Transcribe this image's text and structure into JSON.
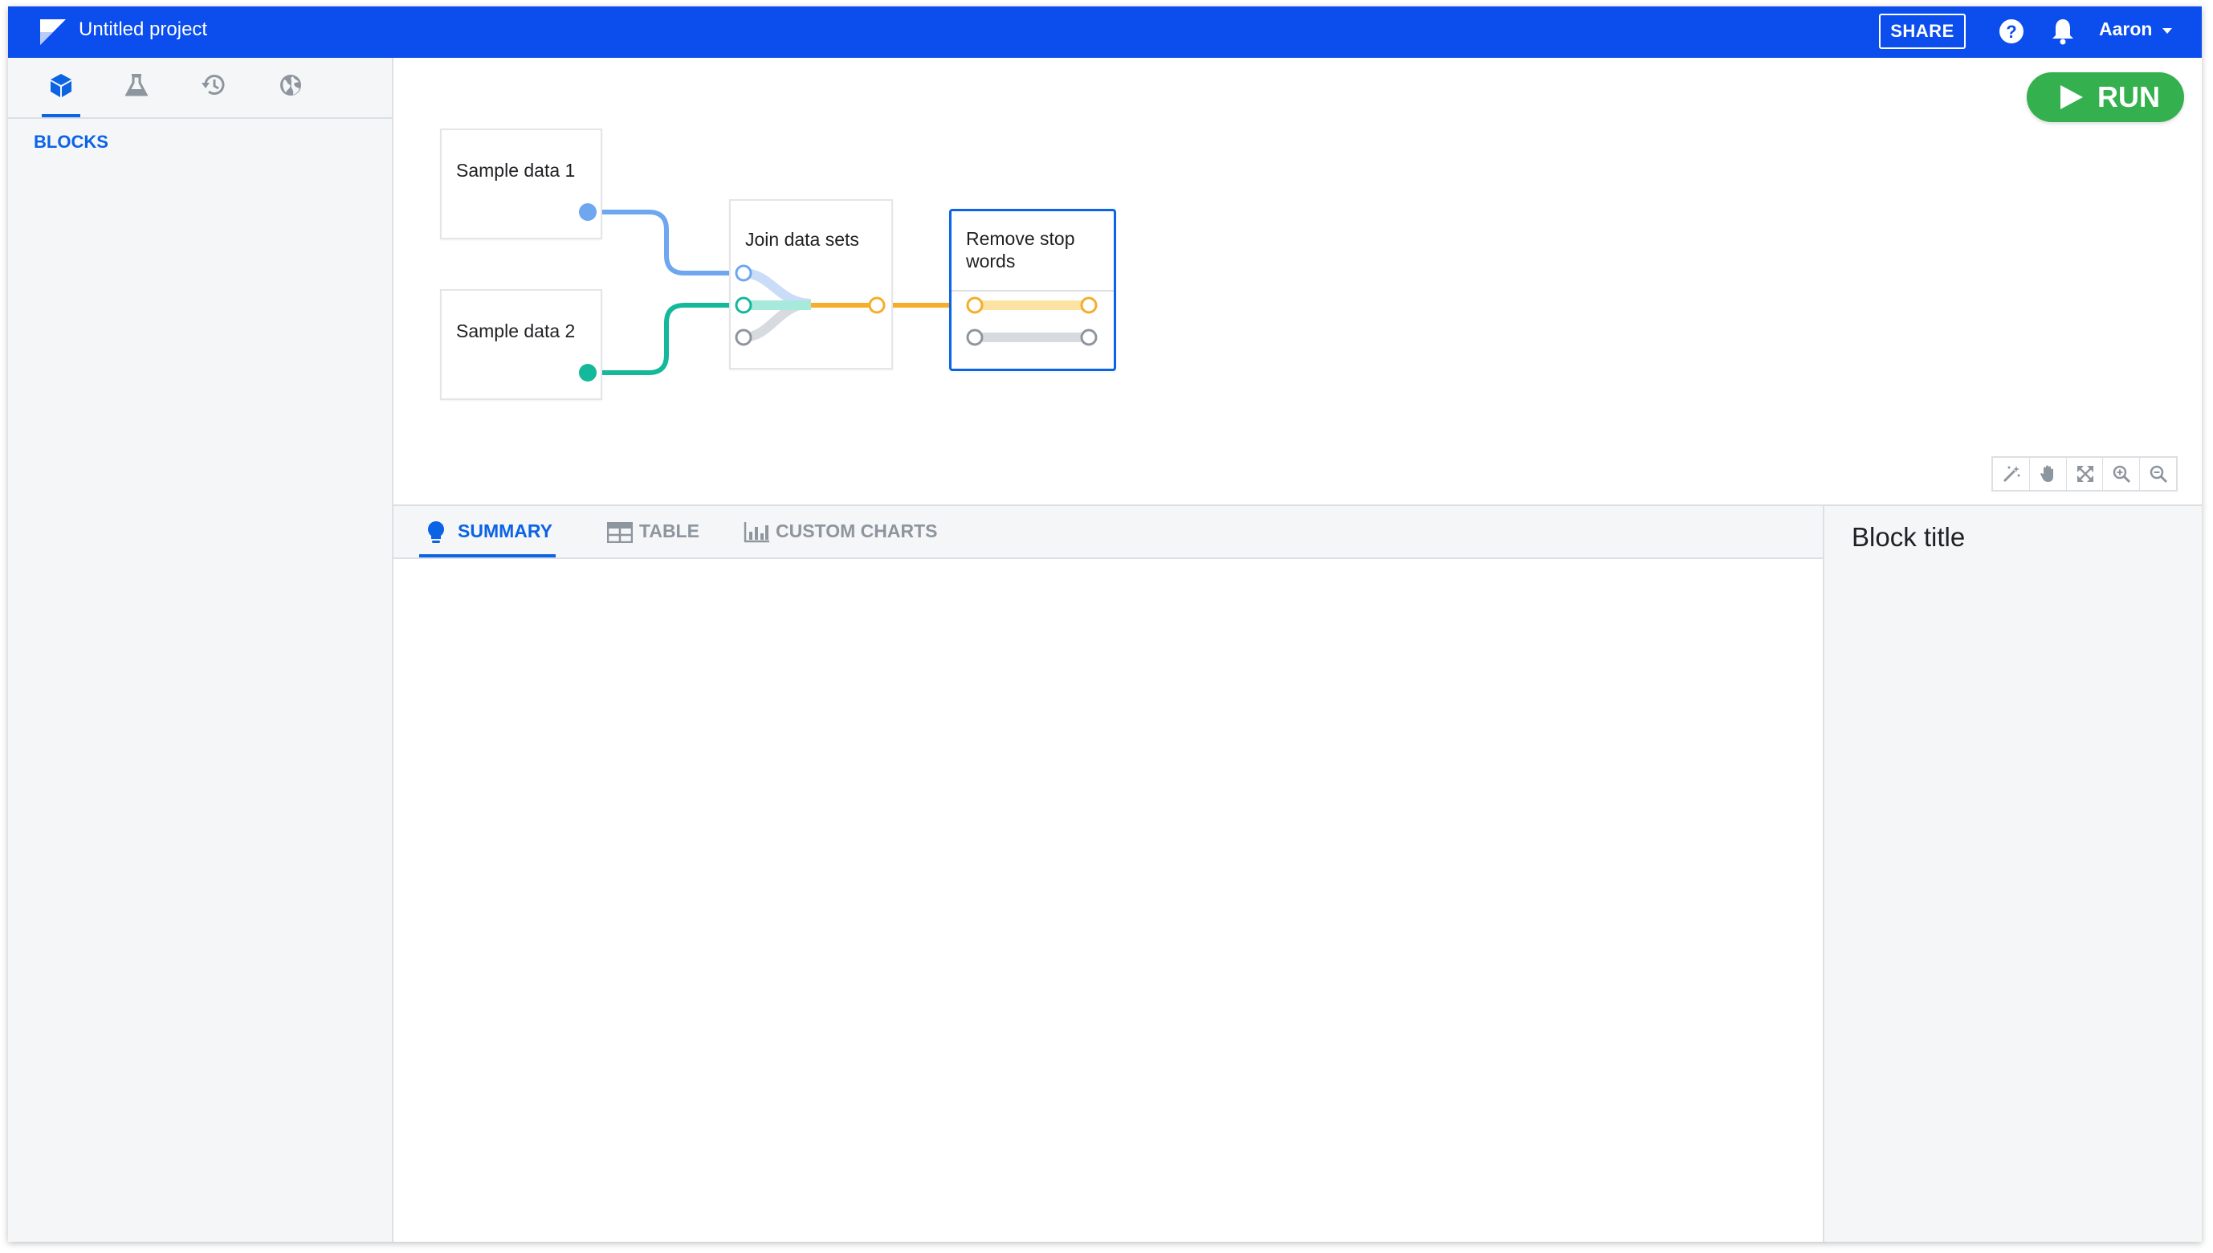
{
  "header": {
    "project_title": "Untitled project",
    "share_label": "SHARE",
    "user_name": "Aaron",
    "icons": [
      "logo-icon",
      "help-icon",
      "bell-icon",
      "chevron-down-icon"
    ]
  },
  "left_panel": {
    "tabs": [
      {
        "name": "blocks",
        "icon": "cube-icon",
        "active": true
      },
      {
        "name": "experiments",
        "icon": "flask-icon",
        "active": false
      },
      {
        "name": "history",
        "icon": "history-icon",
        "active": false
      },
      {
        "name": "globe",
        "icon": "globe-icon",
        "active": false
      }
    ],
    "section_label": "BLOCKS"
  },
  "canvas": {
    "run_label": "RUN",
    "nodes": [
      {
        "id": "sample1",
        "label": "Sample data 1"
      },
      {
        "id": "sample2",
        "label": "Sample data 2"
      },
      {
        "id": "join",
        "label": "Join data sets"
      },
      {
        "id": "remove",
        "label": "Remove stop words",
        "selected": true
      }
    ],
    "zoom_tools": [
      "magic-wand-icon",
      "hand-icon",
      "fit-screen-icon",
      "zoom-in-icon",
      "zoom-out-icon"
    ]
  },
  "bottom_tabs": [
    {
      "label": "SUMMARY",
      "icon": "lightbulb-icon",
      "active": true
    },
    {
      "label": "TABLE",
      "icon": "table-icon",
      "active": false
    },
    {
      "label": "CUSTOM CHARTS",
      "icon": "bar-chart-icon",
      "active": false
    }
  ],
  "side_panel": {
    "title": "Block title"
  },
  "colors": {
    "topbar": "#0b4ded",
    "accent": "#0b63e5",
    "run_green": "#34b04e",
    "wire_blue": "#6ea6f0",
    "wire_teal": "#14b89a",
    "wire_orange": "#f5ad2a",
    "wire_grey": "#8d959e"
  }
}
